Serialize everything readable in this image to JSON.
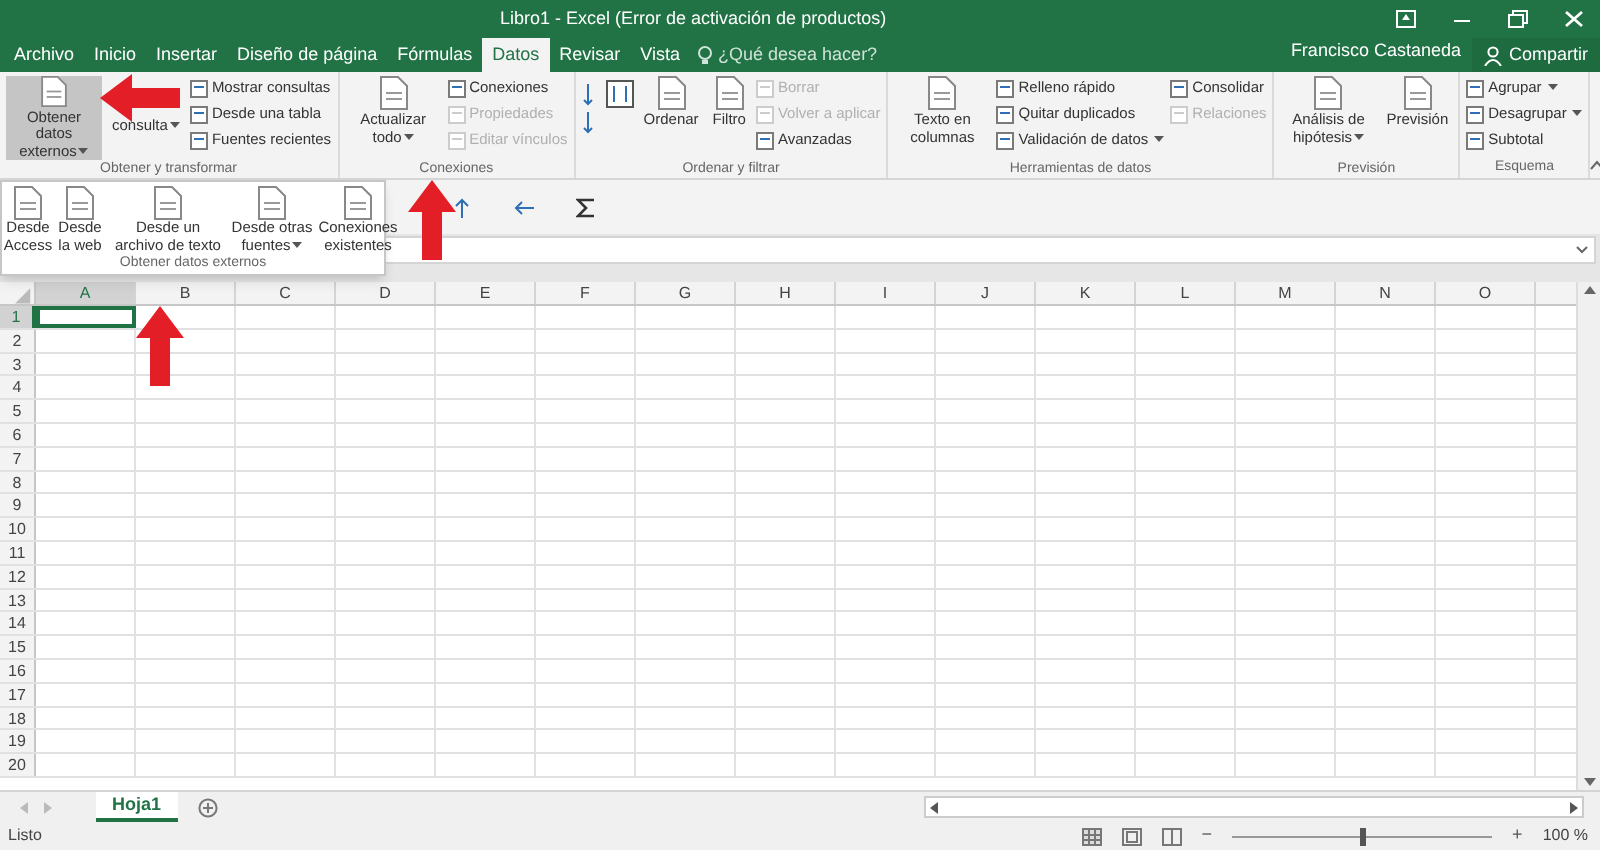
{
  "window": {
    "title": "Libro1 - Excel (Error de activación de productos)"
  },
  "tabs": [
    {
      "label": "Archivo",
      "selected": false
    },
    {
      "label": "Inicio",
      "selected": false
    },
    {
      "label": "Insertar",
      "selected": false
    },
    {
      "label": "Diseño de página",
      "selected": false
    },
    {
      "label": "Fórmulas",
      "selected": false
    },
    {
      "label": "Datos",
      "selected": true
    },
    {
      "label": "Revisar",
      "selected": false
    },
    {
      "label": "Vista",
      "selected": false
    }
  ],
  "tell_me": {
    "placeholder": "¿Qué desea hacer?"
  },
  "user": "Francisco Castaneda",
  "share_button": "Compartir",
  "ribbon_groups": [
    {
      "label": "Obtener y transformar",
      "items": [
        {
          "kind": "large",
          "label": "Obtener datos externos",
          "dropdown": true,
          "selected": true
        },
        {
          "kind": "covered_large",
          "label": "consulta",
          "dropdown": true,
          "selected": false
        },
        {
          "kind": "stack",
          "items": [
            {
              "label": "Mostrar consultas",
              "disabled": false,
              "dropdown": false
            },
            {
              "label": "Desde una tabla",
              "disabled": false,
              "dropdown": false
            },
            {
              "label": "Fuentes recientes",
              "disabled": false,
              "dropdown": false
            }
          ]
        }
      ]
    },
    {
      "label": "Conexiones",
      "items": [
        {
          "kind": "large",
          "label": "Actualizar todo",
          "dropdown": true,
          "selected": false
        },
        {
          "kind": "stack",
          "items": [
            {
              "label": "Conexiones",
              "disabled": false,
              "dropdown": false
            },
            {
              "label": "Propiedades",
              "disabled": true,
              "dropdown": false
            },
            {
              "label": "Editar vínculos",
              "disabled": true,
              "dropdown": false
            }
          ]
        }
      ]
    },
    {
      "label": "Ordenar y filtrar",
      "items": [
        {
          "kind": "sort"
        },
        {
          "kind": "large",
          "label": "Ordenar",
          "dropdown": false,
          "selected": false
        },
        {
          "kind": "large",
          "label": "Filtro",
          "dropdown": false,
          "selected": false
        },
        {
          "kind": "stack",
          "items": [
            {
              "label": "Borrar",
              "disabled": true,
              "dropdown": false
            },
            {
              "label": "Volver a aplicar",
              "disabled": true,
              "dropdown": false
            },
            {
              "label": "Avanzadas",
              "disabled": false,
              "dropdown": false
            }
          ]
        }
      ]
    },
    {
      "label": "Herramientas de datos",
      "items": [
        {
          "kind": "large",
          "label": "Texto en columnas",
          "dropdown": false,
          "selected": false
        },
        {
          "kind": "stack",
          "items": [
            {
              "label": "Relleno rápido",
              "disabled": false,
              "dropdown": false
            },
            {
              "label": "Quitar duplicados",
              "disabled": false,
              "dropdown": false
            },
            {
              "label": "Validación de datos",
              "disabled": false,
              "dropdown": true
            }
          ]
        },
        {
          "kind": "stack",
          "items": [
            {
              "label": "Consolidar",
              "disabled": false,
              "dropdown": false
            },
            {
              "label": "Relaciones",
              "disabled": true,
              "dropdown": false
            }
          ]
        }
      ]
    },
    {
      "label": "Previsión",
      "items": [
        {
          "kind": "large",
          "label": "Análisis de hipótesis",
          "dropdown": true,
          "selected": false
        },
        {
          "kind": "large",
          "label": "Previsión",
          "dropdown": false,
          "selected": false
        }
      ]
    },
    {
      "label": "Esquema",
      "items": [
        {
          "kind": "stack",
          "items": [
            {
              "label": "Agrupar",
              "disabled": false,
              "dropdown": true
            },
            {
              "label": "Desagrupar",
              "disabled": false,
              "dropdown": true
            },
            {
              "label": "Subtotal",
              "disabled": false,
              "dropdown": false
            }
          ]
        }
      ]
    }
  ],
  "external_data_menu": {
    "label": "Obtener datos externos",
    "items": [
      {
        "label": "Desde Access",
        "dropdown": false
      },
      {
        "label": "Desde la web",
        "dropdown": false
      },
      {
        "label": "Desde un archivo de texto",
        "dropdown": false
      },
      {
        "label": "Desde otras fuentes",
        "dropdown": true
      },
      {
        "label": "Conexiones existentes",
        "dropdown": false
      }
    ]
  },
  "grid": {
    "columns": [
      {
        "label": "A",
        "selected": true
      },
      {
        "label": "B",
        "selected": false
      },
      {
        "label": "C",
        "selected": false
      },
      {
        "label": "D",
        "selected": false
      },
      {
        "label": "E",
        "selected": false
      },
      {
        "label": "F",
        "selected": false
      },
      {
        "label": "G",
        "selected": false
      },
      {
        "label": "H",
        "selected": false
      },
      {
        "label": "I",
        "selected": false
      },
      {
        "label": "J",
        "selected": false
      },
      {
        "label": "K",
        "selected": false
      },
      {
        "label": "L",
        "selected": false
      },
      {
        "label": "M",
        "selected": false
      },
      {
        "label": "N",
        "selected": false
      },
      {
        "label": "O",
        "selected": false
      }
    ],
    "rows": [
      {
        "label": "1",
        "selected": true
      },
      {
        "label": "2",
        "selected": false
      },
      {
        "label": "3",
        "selected": false
      },
      {
        "label": "4",
        "selected": false
      },
      {
        "label": "5",
        "selected": false
      },
      {
        "label": "6",
        "selected": false
      },
      {
        "label": "7",
        "selected": false
      },
      {
        "label": "8",
        "selected": false
      },
      {
        "label": "9",
        "selected": false
      },
      {
        "label": "10",
        "selected": false
      },
      {
        "label": "11",
        "selected": false
      },
      {
        "label": "12",
        "selected": false
      },
      {
        "label": "13",
        "selected": false
      },
      {
        "label": "14",
        "selected": false
      },
      {
        "label": "15",
        "selected": false
      },
      {
        "label": "16",
        "selected": false
      },
      {
        "label": "17",
        "selected": false
      },
      {
        "label": "18",
        "selected": false
      },
      {
        "label": "19",
        "selected": false
      },
      {
        "label": "20",
        "selected": false
      }
    ]
  },
  "sheets": [
    {
      "label": "Hoja1",
      "selected": true
    }
  ],
  "status_bar": {
    "status": "Listo",
    "zoom": "100 %",
    "zoom_out": "−",
    "zoom_in": "+",
    "zoom_level": {
      "level": 0.5
    }
  }
}
